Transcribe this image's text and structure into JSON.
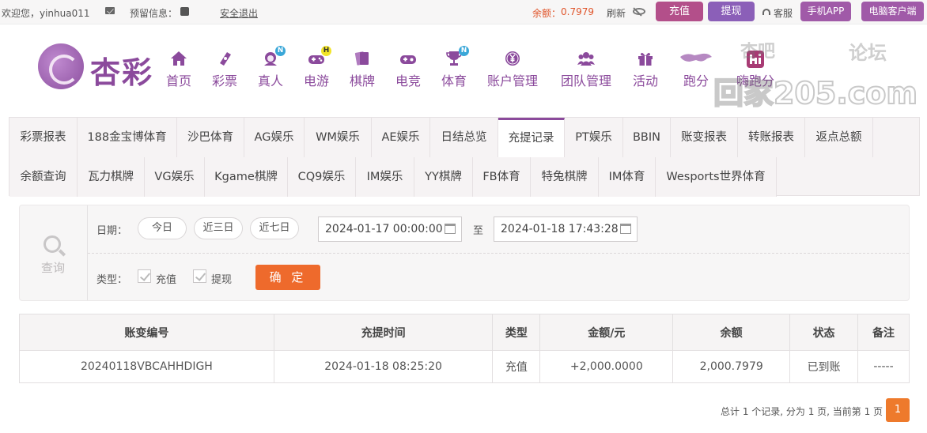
{
  "topbar": {
    "greeting": "欢迎您，yinhua011",
    "messages_label": "预留信息：",
    "logout_label": "安全退出",
    "balance_label": "余额：",
    "balance_value": "0.7979",
    "refresh_label": "刷新",
    "deposit_label": "充值",
    "withdraw_label": "提现",
    "service_label": "客服",
    "app_label": "手机APP",
    "pc_client_label": "电脑客户端"
  },
  "brand": {
    "logo_text": "杏彩",
    "color": "#8b4a9c"
  },
  "nav": [
    {
      "label": "首页",
      "icon": "home-icon"
    },
    {
      "label": "彩票",
      "icon": "lottery-ticket-icon"
    },
    {
      "label": "真人",
      "icon": "live-dealer-icon",
      "badge": "N"
    },
    {
      "label": "电游",
      "icon": "gamepad-icon",
      "badge": "H"
    },
    {
      "label": "棋牌",
      "icon": "cards-icon"
    },
    {
      "label": "电竞",
      "icon": "esports-gamepad-icon"
    },
    {
      "label": "体育",
      "icon": "trophy-icon",
      "badge": "N"
    },
    {
      "label": "账户管理",
      "icon": "yen-coin-icon"
    },
    {
      "label": "团队管理",
      "icon": "team-icon"
    },
    {
      "label": "活动",
      "icon": "gift-icon"
    },
    {
      "label": "跑分",
      "icon": "running-dog-icon"
    },
    {
      "label": "嗨跑分",
      "icon": "hi-app-icon"
    }
  ],
  "watermark": {
    "line1a": "杏吧",
    "line1b": "论坛",
    "line2": "回家205.com"
  },
  "tabs_row1": [
    "彩票报表",
    "188金宝博体育",
    "沙巴体育",
    "AG娱乐",
    "WM娱乐",
    "AE娱乐",
    "日结总览",
    "充提记录",
    "PT娱乐",
    "BBIN",
    "账变报表",
    "转账报表",
    "返点总额"
  ],
  "tabs_row2": [
    "余额查询",
    "瓦力棋牌",
    "VG娱乐",
    "Kgame棋牌",
    "CQ9娱乐",
    "IM娱乐",
    "YY棋牌",
    "FB体育",
    "特兔棋牌",
    "IM体育",
    "Wesports世界体育"
  ],
  "active_tab": "充提记录",
  "query": {
    "panel_label": "查询",
    "date_label": "日期：",
    "quick_ranges": [
      "今日",
      "近三日",
      "近七日"
    ],
    "start_date": "2024-01-17 00:00:00",
    "to_label": "至",
    "end_date": "2024-01-18 17:43:28",
    "type_label": "类型：",
    "type_options": [
      "充值",
      "提现"
    ],
    "confirm_label": "确 定"
  },
  "table": {
    "headers": [
      "账变编号",
      "充提时间",
      "类型",
      "金额/元",
      "余额",
      "状态",
      "备注"
    ],
    "rows": [
      [
        "20240118VBCAHHDIGH",
        "2024-01-18 08:25:20",
        "充值",
        "+2,000.0000",
        "2,000.7979",
        "已到账",
        "-----"
      ]
    ]
  },
  "pagination": {
    "summary": "总计 1 个记录, 分为 1 页, 当前第 1 页",
    "current_page": "1"
  },
  "colors": {
    "accent": "#8b4a9c",
    "deposit_button": "#b34f8a",
    "withdraw_button": "#8b5fb8",
    "confirm_button": "#ee6a2c",
    "amount_positive": "#d0322a",
    "status_success": "#4ea83a",
    "balance_text": "#e0552b"
  }
}
